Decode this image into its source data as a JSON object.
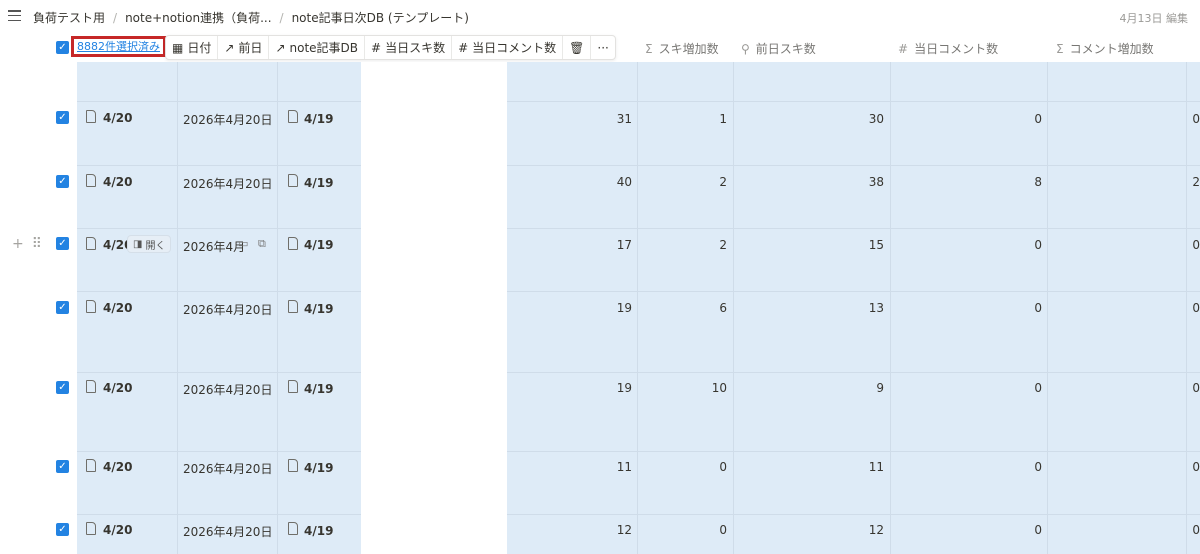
{
  "breadcrumb": [
    "負荷テスト用",
    "note+notion連携（負荷...",
    "note記事日次DB (テンプレート)"
  ],
  "edited_label": "4月13日 編集",
  "selection": {
    "count_label": "8882件選択済み"
  },
  "actions": [
    "日付",
    "前日",
    "note記事DB",
    "当日スキ数",
    "当日コメント数"
  ],
  "columns": {
    "suki_increase": "スキ増加数",
    "prev_suki": "前日スキ数",
    "today_comments": "当日コメント数",
    "comment_increase": "コメント増加数"
  },
  "hover_row": {
    "open_label": "開く",
    "date_truncated": "2026年4月"
  },
  "rows": [
    {
      "name": "4/20",
      "date": "2026年4月20日",
      "prev": "4/19",
      "suki": "31",
      "suki_inc": "1",
      "prev_suki": "30",
      "comments": "0",
      "comment_inc": "0"
    },
    {
      "name": "4/20",
      "date": "2026年4月20日",
      "prev": "4/19",
      "suki": "40",
      "suki_inc": "2",
      "prev_suki": "38",
      "comments": "8",
      "comment_inc": "2"
    },
    {
      "name": "4/20",
      "date": "2026年4月",
      "prev": "4/19",
      "suki": "17",
      "suki_inc": "2",
      "prev_suki": "15",
      "comments": "0",
      "comment_inc": "0"
    },
    {
      "name": "4/20",
      "date": "2026年4月20日",
      "prev": "4/19",
      "suki": "19",
      "suki_inc": "6",
      "prev_suki": "13",
      "comments": "0",
      "comment_inc": "0"
    },
    {
      "name": "4/20",
      "date": "2026年4月20日",
      "prev": "4/19",
      "suki": "19",
      "suki_inc": "10",
      "prev_suki": "9",
      "comments": "0",
      "comment_inc": "0"
    },
    {
      "name": "4/20",
      "date": "2026年4月20日",
      "prev": "4/19",
      "suki": "11",
      "suki_inc": "0",
      "prev_suki": "11",
      "comments": "0",
      "comment_inc": "0"
    },
    {
      "name": "4/20",
      "date": "2026年4月20日",
      "prev": "4/19",
      "suki": "12",
      "suki_inc": "0",
      "prev_suki": "12",
      "comments": "0",
      "comment_inc": "0"
    }
  ]
}
